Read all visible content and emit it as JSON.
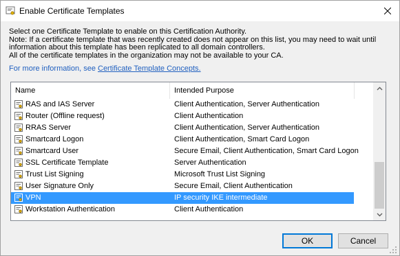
{
  "window": {
    "title": "Enable Certificate Templates",
    "close_glyph": "✕"
  },
  "description": {
    "line1": "Select one Certificate Template to enable on this Certification Authority.",
    "line2": "Note: If a certificate template that was recently created does not appear on this list, you may need to wait until",
    "line3": "information about this template has been replicated to all domain controllers.",
    "line4": "All of the certificate templates in the organization may not be available to your CA.",
    "more_info_prefix": "For more information, see ",
    "more_info_link": "Certificate Template Concepts.",
    "link_color": "#1f5fbf"
  },
  "list": {
    "columns": [
      "Name",
      "Intended Purpose"
    ],
    "selected_color": "#3399ff",
    "rows": [
      {
        "name": "RAS and IAS Server",
        "purpose": "Client Authentication, Server Authentication",
        "selected": false
      },
      {
        "name": "Router (Offline request)",
        "purpose": "Client Authentication",
        "selected": false
      },
      {
        "name": "RRAS Server",
        "purpose": "Client Authentication, Server Authentication",
        "selected": false
      },
      {
        "name": "Smartcard Logon",
        "purpose": "Client Authentication, Smart Card Logon",
        "selected": false
      },
      {
        "name": "Smartcard User",
        "purpose": "Secure Email, Client Authentication, Smart Card Logon",
        "selected": false
      },
      {
        "name": "SSL Certificate Template",
        "purpose": "Server Authentication",
        "selected": false
      },
      {
        "name": "Trust List Signing",
        "purpose": "Microsoft Trust List Signing",
        "selected": false
      },
      {
        "name": "User Signature Only",
        "purpose": "Secure Email, Client Authentication",
        "selected": false
      },
      {
        "name": "VPN",
        "purpose": "IP security IKE intermediate",
        "selected": true
      },
      {
        "name": "Workstation Authentication",
        "purpose": "Client Authentication",
        "selected": false
      }
    ],
    "row_icon": "certificate-template-icon"
  },
  "buttons": {
    "ok": "OK",
    "cancel": "Cancel"
  }
}
